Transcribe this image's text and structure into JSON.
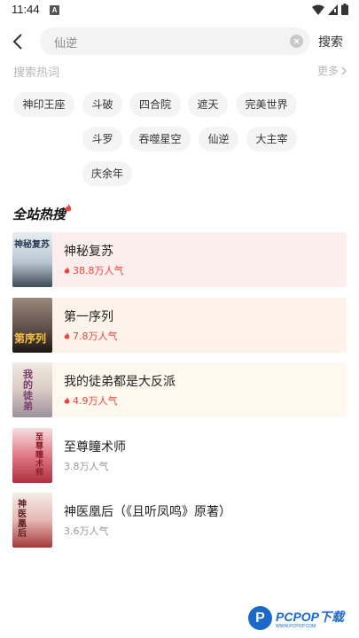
{
  "status_bar": {
    "time": "11:44",
    "notif_letter": "A"
  },
  "search": {
    "value": "仙逆",
    "button_label": "搜索"
  },
  "hot_words": {
    "title": "搜索热词",
    "more_label": "更多",
    "chips": [
      "神印王座",
      "斗破",
      "四合院",
      "遮天",
      "完美世界",
      "斗罗",
      "吞噬星空",
      "仙逆",
      "大主宰",
      "庆余年"
    ]
  },
  "ranking": {
    "title": "全站热搜",
    "books": [
      {
        "title": "神秘复苏",
        "popularity": "38.8万人气",
        "cover_text": "神秘复苏",
        "hot": true
      },
      {
        "title": "第一序列",
        "popularity": "7.8万人气",
        "cover_text": "第序列",
        "hot": true
      },
      {
        "title": "我的徒弟都是大反派",
        "popularity": "4.9万人气",
        "cover_text": "我的徒弟",
        "hot": true
      },
      {
        "title": "至尊瞳术师",
        "popularity": "3.8万人气",
        "cover_text": "至尊瞳术师",
        "hot": false
      },
      {
        "title": "神医凰后（《且听凤鸣》原著）",
        "popularity": "3.6万人气",
        "cover_text": "神医凰后",
        "hot": false
      }
    ]
  },
  "watermark": {
    "letter": "P",
    "text": "PCPOP下载",
    "sub": "WWW.PCPOP.COM"
  },
  "colors": {
    "hot_red": "#e8473c",
    "row1_bg": "#fdeeee",
    "row2_bg": "#fef3ea",
    "row3_bg": "#fef8ee",
    "muted": "#999999",
    "brand_blue": "#1b68c8"
  }
}
